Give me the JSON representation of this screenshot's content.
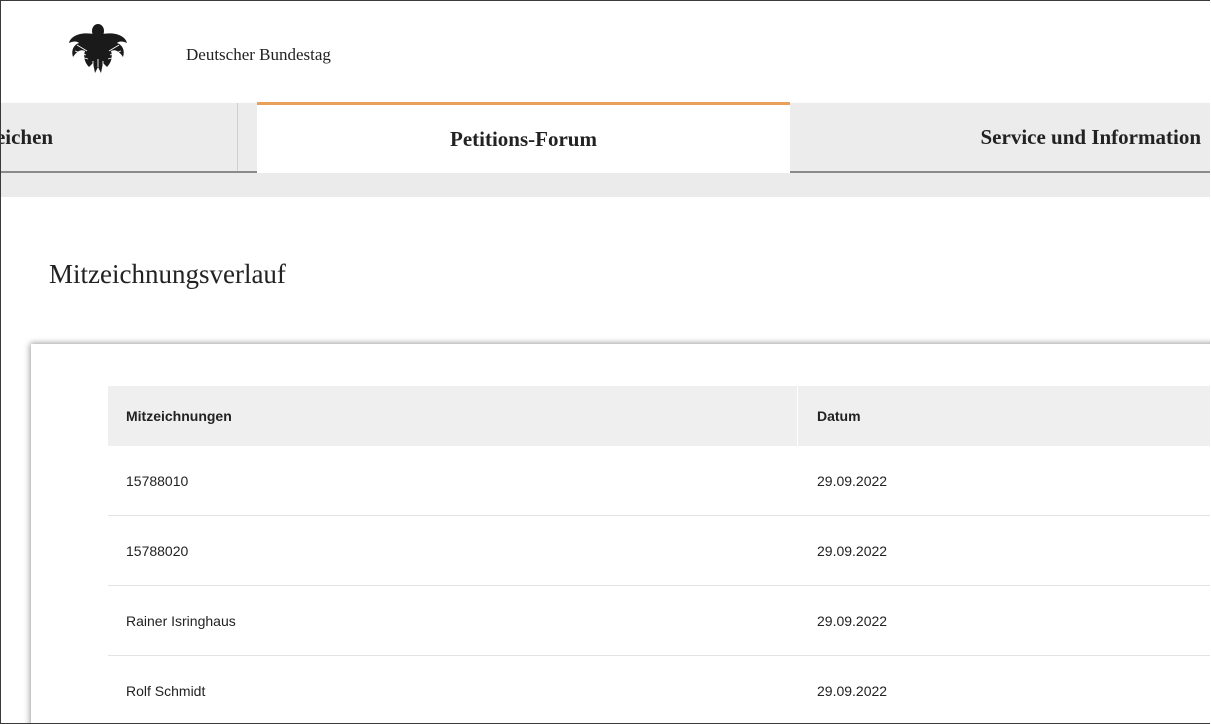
{
  "header": {
    "brand": "Deutscher Bundestag",
    "logo_icon": "federal-eagle-icon"
  },
  "nav": {
    "tabs": [
      {
        "label": "reichen",
        "active": false
      },
      {
        "label": "Petitions-Forum",
        "active": true
      },
      {
        "label": "Service und Information",
        "active": false
      }
    ],
    "active_accent": "#e8a05a"
  },
  "main": {
    "title": "Mitzeichnungsverlauf",
    "table": {
      "columns": [
        "Mitzeichnungen",
        "Datum"
      ],
      "rows": [
        {
          "name": "15788010",
          "date": "29.09.2022"
        },
        {
          "name": "15788020",
          "date": "29.09.2022"
        },
        {
          "name": "Rainer Isringhaus",
          "date": "29.09.2022"
        },
        {
          "name": "Rolf Schmidt",
          "date": "29.09.2022"
        }
      ]
    }
  }
}
